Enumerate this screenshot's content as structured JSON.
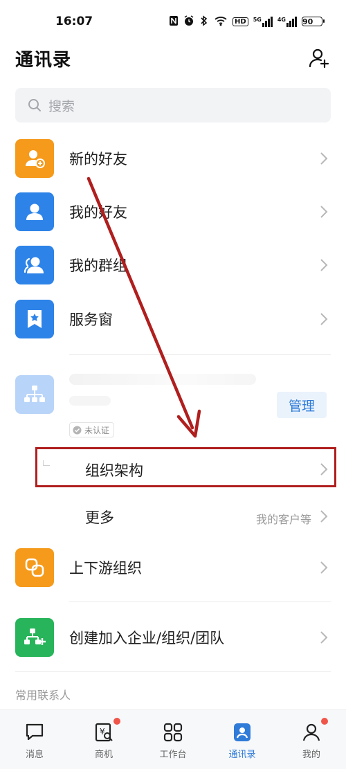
{
  "status_bar": {
    "time": "16:07",
    "icons": [
      "nfc-icon",
      "alarm-icon",
      "bluetooth-icon",
      "wifi-icon",
      "hd-icon",
      "signal-5g-icon",
      "signal-4g-icon"
    ],
    "hd": "HD",
    "net1": "5G",
    "net2": "4G",
    "battery": "90"
  },
  "header": {
    "title": "通讯录"
  },
  "search": {
    "placeholder": "搜索"
  },
  "rows": [
    {
      "label": "新的好友",
      "color": "#f59a1b"
    },
    {
      "label": "我的好友",
      "color": "#2d83e8"
    },
    {
      "label": "我的群组",
      "color": "#2d83e8"
    },
    {
      "label": "服务窗",
      "color": "#2d83e8"
    }
  ],
  "org": {
    "manage_label": "管理",
    "badge": "未认证",
    "logo_color": "#b9d4f9",
    "sub_items": [
      {
        "label": "组织架构",
        "extra": ""
      },
      {
        "label": "更多",
        "extra": "我的客户等"
      }
    ]
  },
  "rows2": [
    {
      "label": "上下游组织",
      "color": "#f59a1b"
    },
    {
      "label": "创建加入企业/组织/团队",
      "color": "#27b45a"
    }
  ],
  "section": {
    "frequent_title": "常用联系人"
  },
  "tabs": [
    {
      "label": "消息",
      "icon": "message-icon",
      "active": false,
      "dot": false
    },
    {
      "label": "商机",
      "icon": "business-icon",
      "active": false,
      "dot": true
    },
    {
      "label": "工作台",
      "icon": "workbench-icon",
      "active": false,
      "dot": false
    },
    {
      "label": "通讯录",
      "icon": "contacts-icon",
      "active": true,
      "dot": false
    },
    {
      "label": "我的",
      "icon": "profile-icon",
      "active": false,
      "dot": true
    }
  ],
  "colors": {
    "accent": "#2f7bd8",
    "annotation": "#b01e1e",
    "badge_dot": "#f0554a"
  }
}
